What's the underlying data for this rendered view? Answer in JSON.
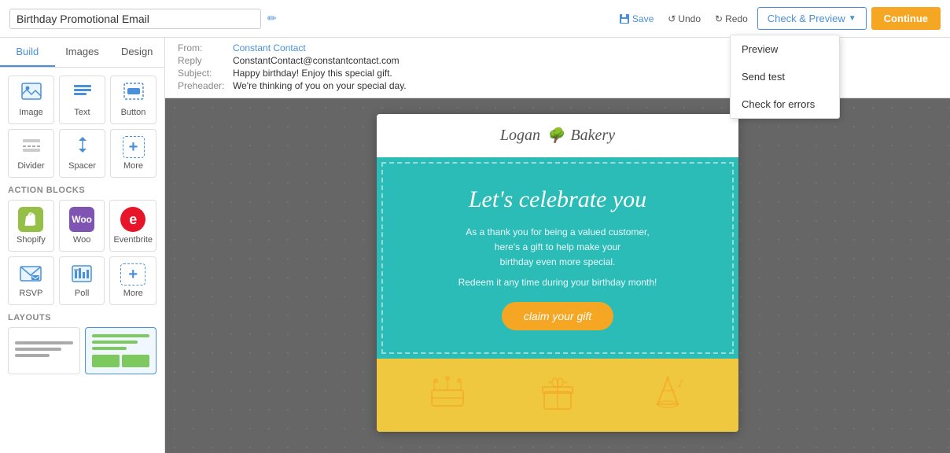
{
  "topbar": {
    "title": "Birthday Promotional Email",
    "edit_icon": "✏",
    "save_label": "Save",
    "undo_label": "Undo",
    "redo_label": "Redo",
    "check_preview_label": "Check & Preview",
    "continue_label": "Continue"
  },
  "dropdown": {
    "items": [
      "Preview",
      "Send test",
      "Check for errors"
    ]
  },
  "sidebar": {
    "tabs": [
      "Build",
      "Images",
      "Design"
    ],
    "active_tab": "Build",
    "blocks": [
      {
        "label": "Image",
        "icon": "🖼"
      },
      {
        "label": "Text",
        "icon": "T"
      },
      {
        "label": "Button",
        "icon": "⬜"
      },
      {
        "label": "Divider",
        "icon": "—"
      },
      {
        "label": "Spacer",
        "icon": "↕"
      },
      {
        "label": "More",
        "icon": "+"
      }
    ],
    "action_blocks_label": "Action Blocks",
    "action_blocks": [
      {
        "label": "Shopify",
        "type": "shopify"
      },
      {
        "label": "Woo",
        "type": "woo"
      },
      {
        "label": "Eventbrite",
        "type": "eventbrite"
      },
      {
        "label": "RSVP",
        "type": "rsvp"
      },
      {
        "label": "Poll",
        "type": "poll"
      },
      {
        "label": "More",
        "type": "more"
      }
    ],
    "layouts_label": "Layouts"
  },
  "email_meta": {
    "from_label": "From:",
    "from_value": "Constant Contact",
    "reply_label": "Reply",
    "reply_value": "ConstantContact@constantcontact.com",
    "subject_label": "Subject:",
    "subject_value": "Happy birthday! Enjoy this special gift.",
    "preheader_label": "Preheader:",
    "preheader_value": "We're thinking of you on your special day."
  },
  "email_content": {
    "logo_text": "Logan",
    "logo_suffix": "Bakery",
    "celebrate_title": "Let's celebrate you",
    "subtitle_line1": "As a thank you for being a valued customer,",
    "subtitle_line2": "here's a gift to help make your",
    "subtitle_line3": "birthday even more special.",
    "redeem_text": "Redeem it any time during your birthday month!",
    "claim_btn": "claim your gift"
  }
}
